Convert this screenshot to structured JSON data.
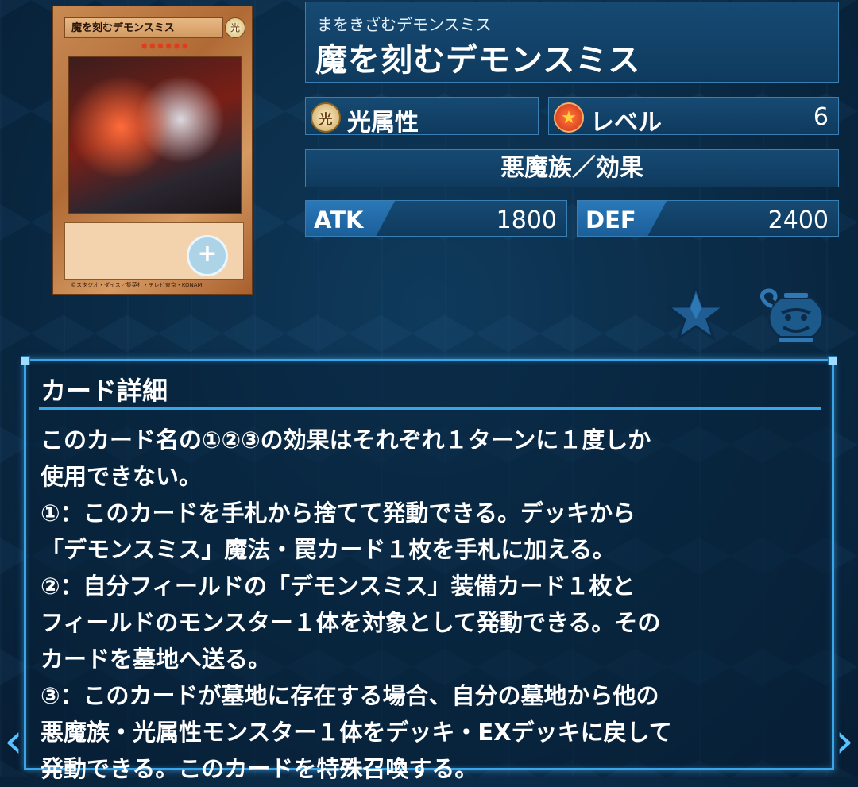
{
  "card_image": {
    "name_label": "魔を刻むデモンスミス",
    "attribute_glyph": "光",
    "level_stars": "✹✹✹✹✹✹",
    "zoom_glyph": "+",
    "footer_text": "©スタジオ・ダイス／集英社・テレビ東京・KONAMI"
  },
  "header": {
    "ruby": "まをきざむデモンスミス",
    "name": "魔を刻むデモンスミス"
  },
  "attribute": {
    "icon": "光",
    "label": "光属性"
  },
  "level": {
    "icon": "★",
    "label": "レベル",
    "value": "6"
  },
  "type_line": "悪魔族／効果",
  "stats": {
    "atk_label": "ATK",
    "atk_value": "1800",
    "def_label": "DEF",
    "def_value": "2400"
  },
  "icons": {
    "favorite": "star-icon",
    "pot": "pot-of-greed-icon"
  },
  "detail": {
    "title": "カード詳細",
    "lines": [
      "このカード名の①②③の効果はそれぞれ１ターンに１度しか",
      "使用できない。",
      "①：このカードを手札から捨てて発動できる。デッキから",
      "「デモンスミス」魔法・罠カード１枚を手札に加える。",
      "②：自分フィールドの「デモンスミス」装備カード１枚と",
      "フィールドのモンスター１体を対象として発動できる。その",
      "カードを墓地へ送る。",
      "③：このカードが墓地に存在する場合、自分の墓地から他の",
      "悪魔族・光属性モンスター１体をデッキ・EXデッキに戻して",
      "発動できる。このカードを特殊召喚する。"
    ]
  },
  "nav": {
    "prev": "‹",
    "next": "›"
  },
  "colors": {
    "frame_accent": "#3aa6ea",
    "panel": "#164a73",
    "card_frame": "#c98a52"
  }
}
